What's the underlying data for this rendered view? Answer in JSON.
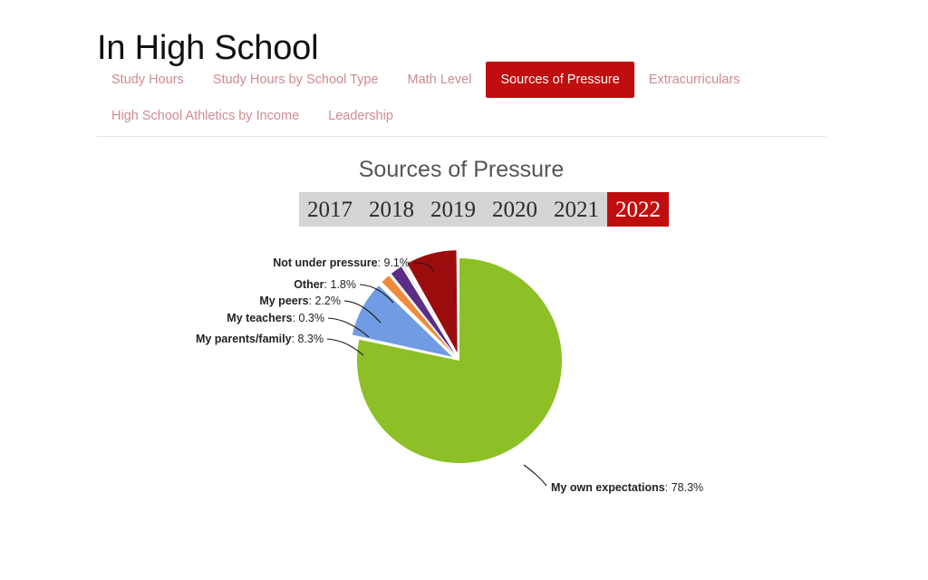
{
  "header": {
    "title": "In High School"
  },
  "tabs": {
    "items": [
      {
        "label": "Study Hours",
        "active": false
      },
      {
        "label": "Study Hours by School Type",
        "active": false
      },
      {
        "label": "Math Level",
        "active": false
      },
      {
        "label": "Sources of Pressure",
        "active": true
      },
      {
        "label": "Extracurriculars",
        "active": false
      },
      {
        "label": "High School Athletics by Income",
        "active": false
      },
      {
        "label": "Leadership",
        "active": false
      }
    ]
  },
  "year_selector": {
    "years": [
      "2017",
      "2018",
      "2019",
      "2020",
      "2021",
      "2022"
    ],
    "selected": "2022",
    "active_color": "#c00d0d",
    "track_color": "#d5d5d5"
  },
  "chart_data": {
    "type": "pie",
    "title": "Sources of Pressure",
    "xlabel": "",
    "ylabel": "",
    "legend_position": "none",
    "units": "percent",
    "labels": [
      "My own expectations",
      "Not under pressure",
      "Other",
      "My peers",
      "My teachers",
      "My parents/family"
    ],
    "values": [
      78.3,
      9.1,
      1.8,
      2.2,
      0.3,
      8.3
    ],
    "colors": [
      "#8cc026",
      "#719ce3",
      "#ef8a3c",
      "#5b2d87",
      "#2c2a6b",
      "#9b0d0d"
    ],
    "exploded": [
      false,
      true,
      true,
      true,
      true,
      true
    ],
    "slices": [
      {
        "name": "My own expectations",
        "value": 78.3,
        "display": "My own expectations: 78.3%",
        "color": "#8cc026"
      },
      {
        "name": "Not under pressure",
        "value": 9.1,
        "display": "Not under pressure: 9.1%",
        "color": "#719ce3"
      },
      {
        "name": "Other",
        "value": 1.8,
        "display": "Other: 1.8%",
        "color": "#ef8a3c"
      },
      {
        "name": "My peers",
        "value": 2.2,
        "display": "My peers: 2.2%",
        "color": "#5b2d87"
      },
      {
        "name": "My teachers",
        "value": 0.3,
        "display": "My teachers: 0.3%",
        "color": "#2c2a6b"
      },
      {
        "name": "My parents/family",
        "value": 8.3,
        "display": "My parents/family: 8.3%",
        "color": "#9b0d0d"
      }
    ],
    "annotations": [
      {
        "name": "Not under pressure",
        "pct": "9.1%"
      },
      {
        "name": "Other",
        "pct": "1.8%"
      },
      {
        "name": "My peers",
        "pct": "2.2%"
      },
      {
        "name": "My teachers",
        "pct": "0.3%"
      },
      {
        "name": "My parents/family",
        "pct": "8.3%"
      },
      {
        "name": "My own expectations",
        "pct": "78.3%"
      }
    ]
  }
}
